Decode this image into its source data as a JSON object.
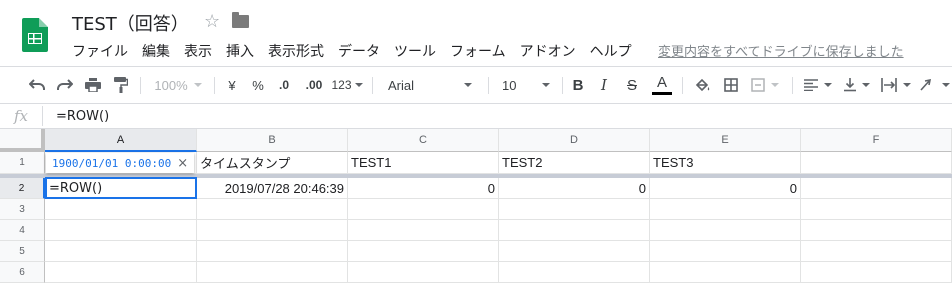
{
  "header": {
    "title": "TEST（回答）",
    "menu": [
      "ファイル",
      "編集",
      "表示",
      "挿入",
      "表示形式",
      "データ",
      "ツール",
      "フォーム",
      "アドオン",
      "ヘルプ"
    ],
    "save_status": "変更内容をすべてドライブに保存しました"
  },
  "toolbar": {
    "zoom": "100%",
    "currency": "¥",
    "percent": "%",
    "decimal_decrease": ".0",
    "decimal_increase": ".00",
    "format_more": "123",
    "font": "Arial",
    "font_size": "10",
    "bold": "B",
    "italic": "I",
    "strike": "S",
    "text_color_letter": "A"
  },
  "formula_bar": {
    "fx": "fx",
    "value": "=ROW()"
  },
  "grid": {
    "columns": [
      "A",
      "B",
      "C",
      "D",
      "E",
      "F"
    ],
    "rows": [
      "1",
      "2",
      "3",
      "4",
      "5",
      "6"
    ],
    "row1": [
      "",
      "タイムスタンプ",
      "TEST1",
      "TEST2",
      "TEST3",
      ""
    ],
    "row2": [
      "=ROW()",
      "2019/07/28 20:46:39",
      "0",
      "0",
      "0",
      ""
    ],
    "active_cell_value": "=ROW()",
    "tooltip": "1900/01/01 0:00:00",
    "tooltip_close": "×"
  },
  "colors": {
    "accent": "#1a73e8",
    "brand": "#0f9d58",
    "text_color_bar": "#000000"
  }
}
